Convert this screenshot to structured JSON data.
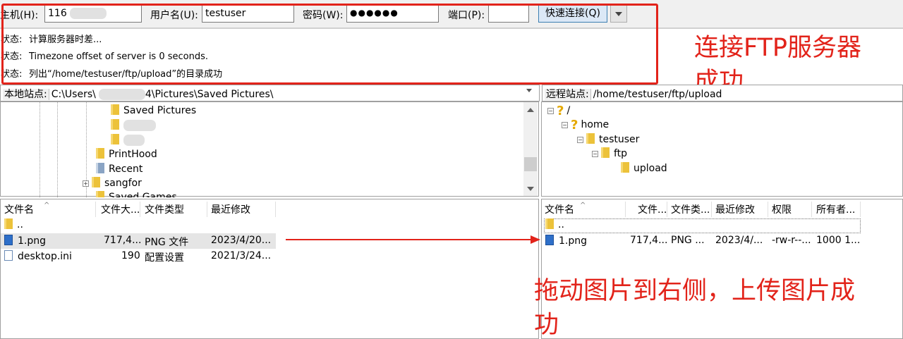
{
  "quickconnect": {
    "host_label": "主机(H):",
    "host_value": "116",
    "user_label": "用户名(U):",
    "user_value": "testuser",
    "password_label": "密码(W):",
    "password_value": "●●●●●●",
    "port_label": "端口(P):",
    "port_value": "",
    "connect_button": "快速连接(Q)"
  },
  "log": [
    {
      "key": "状态:",
      "msg": "计算服务器时差..."
    },
    {
      "key": "状态:",
      "msg": "Timezone offset of server is 0 seconds."
    },
    {
      "key": "状态:",
      "msg": "列出“/home/testuser/ftp/upload”的目录成功"
    }
  ],
  "annotations": {
    "top_line1": "连接FTP服务器",
    "top_line2": "成功",
    "bottom_line1": "拖动图片到右侧，上传图片成",
    "bottom_line2": "功",
    "accent_color": "#e2231a"
  },
  "local": {
    "site_label": "本地站点:",
    "site_path_prefix": "C:\\Users\\",
    "site_path_suffix": "4\\Pictures\\Saved Pictures\\",
    "tree": [
      "Saved Pictures",
      "PrintHood",
      "Recent",
      "sangfor",
      "Saved Games"
    ],
    "columns": [
      "文件名",
      "文件大...",
      "文件类型",
      "最近修改"
    ],
    "files": [
      {
        "name": "..",
        "size": "",
        "type": "",
        "modified": ""
      },
      {
        "name": "1.png",
        "size": "717,4...",
        "type": "PNG 文件",
        "modified": "2023/4/20..."
      },
      {
        "name": "desktop.ini",
        "size": "190",
        "type": "配置设置",
        "modified": "2021/3/24..."
      }
    ]
  },
  "remote": {
    "site_label": "远程站点:",
    "site_path": "/home/testuser/ftp/upload",
    "tree": [
      "/",
      "home",
      "testuser",
      "ftp",
      "upload"
    ],
    "columns": [
      "文件名",
      "文件...",
      "文件类...",
      "最近修改",
      "权限",
      "所有者..."
    ],
    "files": [
      {
        "name": "..",
        "size": "",
        "type": "",
        "modified": "",
        "perm": "",
        "owner": ""
      },
      {
        "name": "1.png",
        "size": "717,4...",
        "type": "PNG ...",
        "modified": "2023/4/...",
        "perm": "-rw-r--...",
        "owner": "1000 1..."
      }
    ]
  }
}
